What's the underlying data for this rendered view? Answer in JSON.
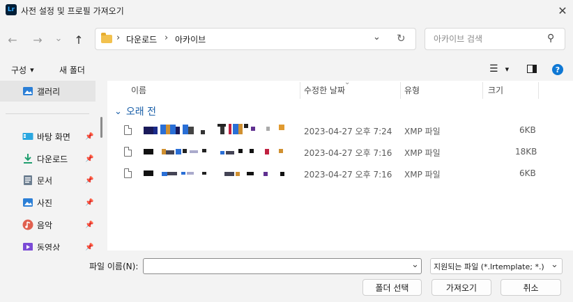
{
  "window": {
    "app_icon_text": "Lr",
    "title": "사전 설정 및 프로필 가져오기",
    "close_glyph": "✕"
  },
  "nav": {
    "back_glyph": "←",
    "forward_glyph": "→",
    "recent_glyph": "⌄",
    "up_glyph": "↑",
    "breadcrumb": [
      "다운로드",
      "아카이브"
    ],
    "crumb_separator": "›",
    "dropdown_glyph": "⌄",
    "refresh_glyph": "↻",
    "search_placeholder": "아카이브 검색",
    "search_glyph": "⚲"
  },
  "commands": {
    "organize": "구성",
    "organize_caret": "▾",
    "new_folder": "새 폴더",
    "view_glyph": "☰",
    "view_caret": "▾",
    "help_glyph": "?"
  },
  "sidebar": {
    "items": [
      {
        "label": "갤러리",
        "icon": "gallery-icon",
        "color": "#2b7fd6",
        "pinned": false,
        "selected": true
      },
      {
        "label": "바탕 화면",
        "icon": "desktop-icon",
        "color": "#2aa7e0",
        "pinned": true
      },
      {
        "label": "다운로드",
        "icon": "download-icon",
        "color": "#1f9e6e",
        "pinned": true
      },
      {
        "label": "문서",
        "icon": "document-icon",
        "color": "#6d7f91",
        "pinned": true
      },
      {
        "label": "사진",
        "icon": "pictures-icon",
        "color": "#2b7fd6",
        "pinned": true
      },
      {
        "label": "음악",
        "icon": "music-icon",
        "color": "#e0604f",
        "pinned": true
      },
      {
        "label": "동영상",
        "icon": "video-icon",
        "color": "#7b4bd6",
        "pinned": true
      }
    ],
    "pin_glyph": "📌"
  },
  "columns": {
    "name": "이름",
    "modified": "수정한 날짜",
    "type": "유형",
    "size": "크기",
    "sort_indicator": "⌄"
  },
  "group": {
    "label": "오래 전",
    "chevron": "⌄"
  },
  "files": [
    {
      "modified": "2023-04-27 오후 7:24",
      "type": "XMP 파일",
      "size": "6KB"
    },
    {
      "modified": "2023-04-27 오후 7:16",
      "type": "XMP 파일",
      "size": "18KB"
    },
    {
      "modified": "2023-04-27 오후 7:16",
      "type": "XMP 파일",
      "size": "6KB"
    }
  ],
  "footer": {
    "filename_label": "파일 이름(N):",
    "filename_value": "",
    "filetype_value": "지원되는 파일 (*.lrtemplate; *.)",
    "select_folder": "폴더 선택",
    "import": "가져오기",
    "cancel": "취소",
    "caret": "⌄"
  },
  "colors": {
    "accent": "#0067c0",
    "selection": "#e5e5e5",
    "background": "#f3f3f3"
  }
}
